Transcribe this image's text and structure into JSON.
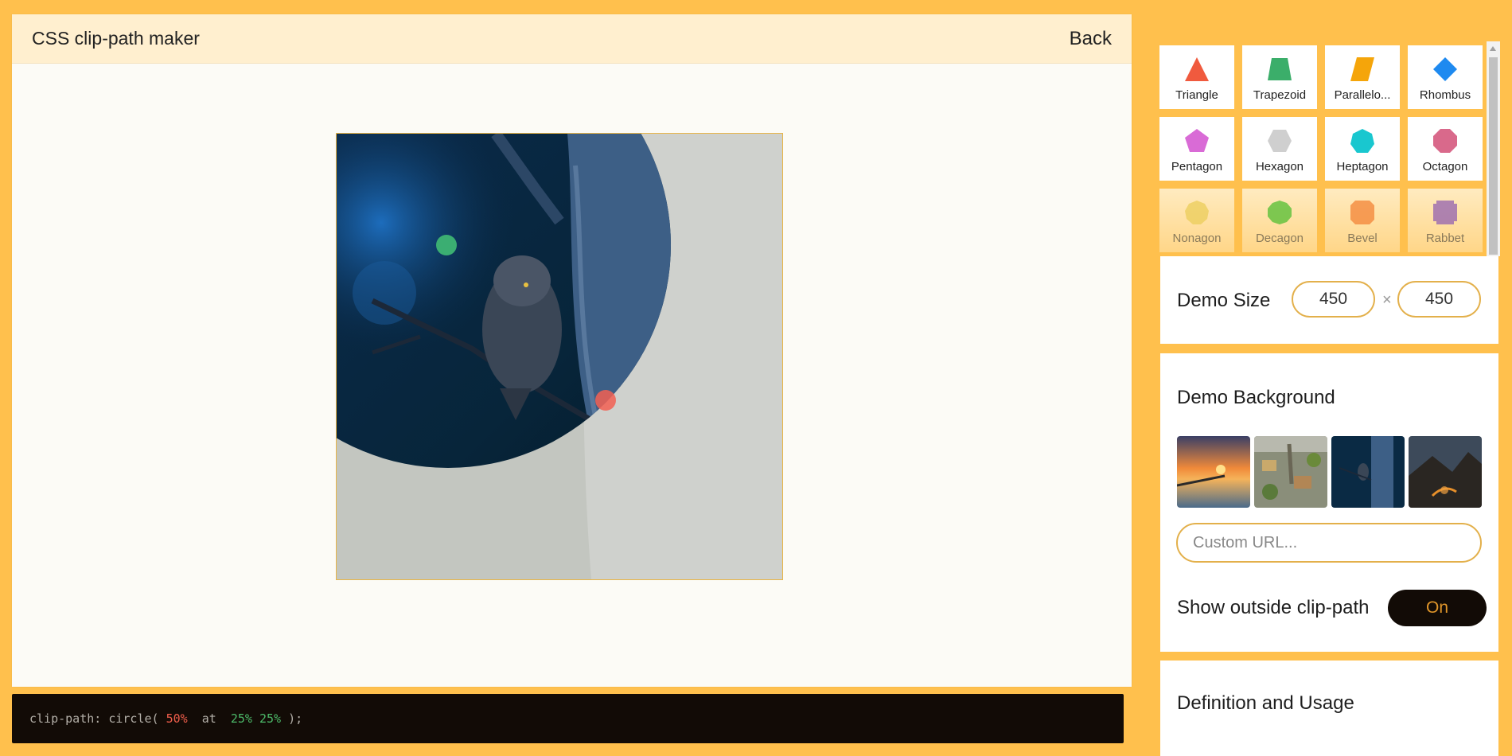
{
  "header": {
    "title": "CSS clip-path maker",
    "back_label": "Back"
  },
  "code": {
    "prefix": "clip-path: circle( ",
    "radius": "50%",
    "at": "  at  ",
    "position": "25% 25%",
    "suffix": " );"
  },
  "shapes": [
    {
      "label": "Triangle",
      "color": "#F05A3E",
      "icon": "triangle-icon"
    },
    {
      "label": "Trapezoid",
      "color": "#3BAE6A",
      "icon": "trapezoid-icon"
    },
    {
      "label": "Parallelo...",
      "color": "#F5A50A",
      "icon": "parallelogram-icon"
    },
    {
      "label": "Rhombus",
      "color": "#1E8AF0",
      "icon": "rhombus-icon"
    },
    {
      "label": "Pentagon",
      "color": "#D96BD6",
      "icon": "pentagon-icon"
    },
    {
      "label": "Hexagon",
      "color": "#CFCFCF",
      "icon": "hexagon-icon"
    },
    {
      "label": "Heptagon",
      "color": "#19C7CF",
      "icon": "heptagon-icon"
    },
    {
      "label": "Octagon",
      "color": "#D9698B",
      "icon": "octagon-icon"
    },
    {
      "label": "Nonagon",
      "color": "#EDCF5F",
      "icon": "nonagon-icon"
    },
    {
      "label": "Decagon",
      "color": "#5DC13A",
      "icon": "decagon-icon"
    },
    {
      "label": "Bevel",
      "color": "#F58A3E",
      "icon": "bevel-icon"
    },
    {
      "label": "Rabbet",
      "color": "#9B6AB0",
      "icon": "rabbet-icon"
    }
  ],
  "demo_size": {
    "label": "Demo Size",
    "width": "450",
    "times": "×",
    "height": "450"
  },
  "demo_background": {
    "label": "Demo Background",
    "thumbnails": [
      "sunset-pier",
      "aerial-town",
      "owl-forest",
      "mountain-night"
    ],
    "url_placeholder": "Custom URL...",
    "show_outside_label": "Show outside clip-path",
    "toggle_label": "On"
  },
  "definition": {
    "label": "Definition and Usage"
  }
}
